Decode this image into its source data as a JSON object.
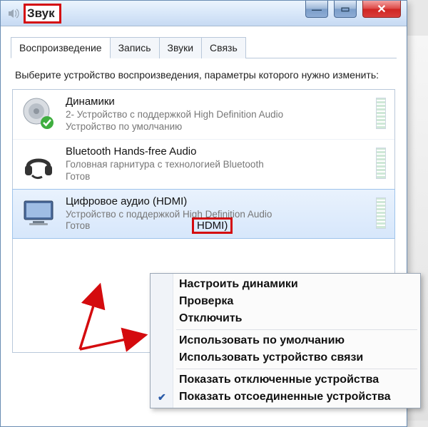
{
  "window": {
    "title": "Звук",
    "buttons": {
      "minimize": "—",
      "maximize": "▭",
      "close": "✕"
    }
  },
  "tabs": [
    {
      "label": "Воспроизведение",
      "active": true
    },
    {
      "label": "Запись",
      "active": false
    },
    {
      "label": "Звуки",
      "active": false
    },
    {
      "label": "Связь",
      "active": false
    }
  ],
  "instruction": "Выберите устройство воспроизведения, параметры которого нужно изменить:",
  "devices": [
    {
      "name": "Динамики",
      "sub": "2- Устройство с поддержкой High Definition Audio",
      "status": "Устройство по умолчанию",
      "icon": "speaker",
      "default": true,
      "selected": false
    },
    {
      "name": "Bluetooth Hands-free Audio",
      "sub": "Головная гарнитура с технологией Bluetooth",
      "status": "Готов",
      "icon": "headset",
      "default": false,
      "selected": false
    },
    {
      "name": "Цифровое аудио (HDMI)",
      "sub": "Устройство с поддержкой High Definition Audio",
      "status": "Готов",
      "icon": "monitor",
      "default": false,
      "selected": true
    }
  ],
  "contextMenu": {
    "items": [
      {
        "label": "Настроить динамики",
        "bold": true
      },
      {
        "label": "Проверка",
        "bold": true
      },
      {
        "label": "Отключить",
        "bold": true
      },
      {
        "sep": true
      },
      {
        "label": "Использовать по умолчанию",
        "bold": true
      },
      {
        "label": "Использовать устройство связи",
        "bold": true
      },
      {
        "sep": true
      },
      {
        "label": "Показать отключенные устройства",
        "bold": true
      },
      {
        "label": "Показать отсоединенные устройства",
        "bold": true,
        "checked": true
      }
    ]
  },
  "annotations": {
    "hdmi_label": "HDMI)"
  }
}
